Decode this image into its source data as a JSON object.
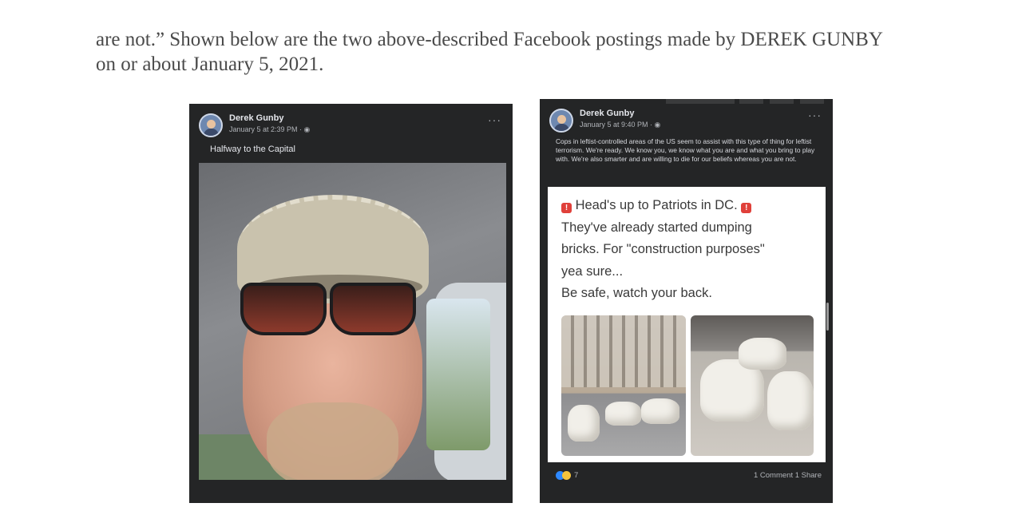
{
  "document": {
    "line1": "are not.”  Shown below are the two above-described Facebook postings made by DEREK GUNBY",
    "line2": "on or about January 5, 2021."
  },
  "post1": {
    "author": "Derek Gunby",
    "timestamp": "January 5 at 2:39 PM · ",
    "privacy_icon": "globe-icon",
    "menu": "···",
    "caption": "Halfway to the Capital"
  },
  "post2": {
    "author": "Derek Gunby",
    "timestamp": "January 5 at 9:40 PM · ",
    "privacy_icon": "globe-icon",
    "menu": "···",
    "caption": "Cops in leftist-controlled areas of the US seem to assist with this type of thing for leftist terrorism.  We're ready.  We know you, we know what you are and what you bring to play with.  We're also smarter and are willing to die for our beliefs whereas you are not.",
    "shared_card": {
      "lines": [
        "Head's up to Patriots in DC.",
        "They've already started dumping",
        "bricks. For \"construction purposes\"",
        "yea sure...",
        "Be safe, watch your back."
      ],
      "warning_glyph": "!"
    },
    "reactions": {
      "count": "7",
      "icons": [
        "like-icon",
        "wow-icon"
      ]
    },
    "comments": "1 Comment  1 Share"
  },
  "colors": {
    "post_bg": "#242526",
    "text_primary": "#e4e6eb",
    "text_secondary": "#b0b3b8",
    "warning_red": "#e0403a"
  }
}
